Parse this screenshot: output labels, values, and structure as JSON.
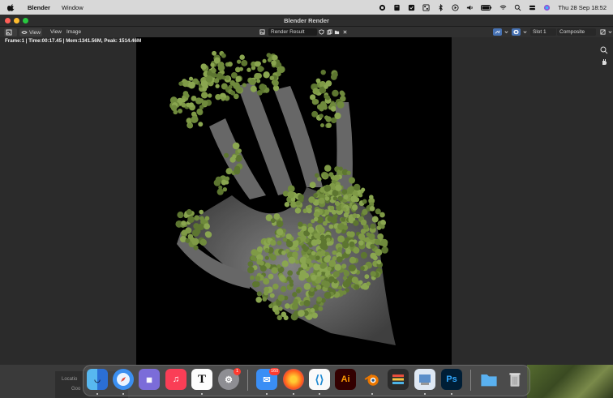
{
  "menubar": {
    "app_name": "Blender",
    "menu_window": "Window",
    "clock": "Thu 28 Sep  18:52"
  },
  "window": {
    "title": "Blender Render"
  },
  "header": {
    "view_label": "View",
    "view_menu": "View",
    "image_menu": "Image",
    "image_name": "Render Result",
    "slot_label": "Slot 1",
    "composite_label": "Composite"
  },
  "render_stats": "Frame:1 | Time:00:17.45 | Mem:1341.56M, Peak: 1514.46M",
  "background_window": {
    "location_label": "Locatio",
    "item_label": "Goo"
  },
  "dock": {
    "apps": [
      {
        "name": "finder",
        "label": ""
      },
      {
        "name": "safari",
        "label": ""
      },
      {
        "name": "launchpad",
        "label": ""
      },
      {
        "name": "music",
        "label": ""
      },
      {
        "name": "typora",
        "label": "T"
      },
      {
        "name": "system-settings",
        "label": "",
        "badge": "1"
      },
      {
        "name": "mail",
        "label": "",
        "badge": "160"
      },
      {
        "name": "firefox",
        "label": ""
      },
      {
        "name": "vscode",
        "label": ""
      },
      {
        "name": "illustrator",
        "label": "Ai"
      },
      {
        "name": "blender",
        "label": ""
      },
      {
        "name": "davinci",
        "label": ""
      },
      {
        "name": "preview",
        "label": ""
      },
      {
        "name": "photoshop",
        "label": "Ps"
      },
      {
        "name": "folder",
        "label": ""
      },
      {
        "name": "trash",
        "label": ""
      }
    ]
  },
  "colors": {
    "moss": "#6f8a3c",
    "hand": "#8a8a8a",
    "traffic_red": "#ff5f57",
    "traffic_yellow": "#febc2e",
    "traffic_green": "#28c840",
    "blender_accent": "#4772b3"
  }
}
